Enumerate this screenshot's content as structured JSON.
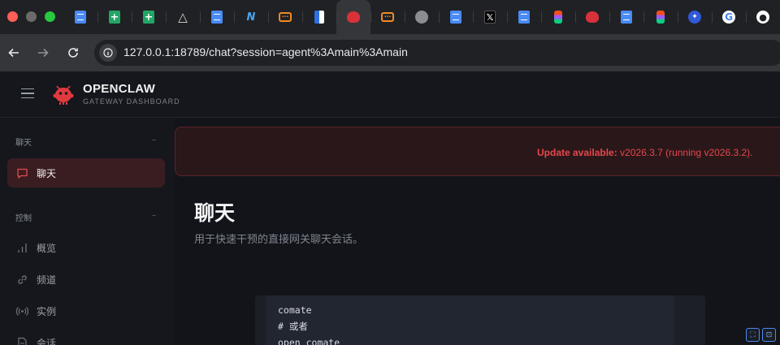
{
  "browser": {
    "tabs": [
      {
        "icon": "google-docs-icon",
        "active": false
      },
      {
        "icon": "google-sheets-icon",
        "active": false
      },
      {
        "icon": "google-sheets-icon",
        "active": false
      },
      {
        "icon": "google-drive-icon",
        "active": false
      },
      {
        "icon": "google-docs-icon",
        "active": false
      },
      {
        "icon": "m-logo-icon",
        "active": false
      },
      {
        "icon": "orange-bracket-icon",
        "active": false
      },
      {
        "icon": "split-doc-icon",
        "active": false
      },
      {
        "icon": "red-robot-icon",
        "active": true
      },
      {
        "icon": "orange-bracket-icon",
        "active": false
      },
      {
        "icon": "globe-icon",
        "active": false
      },
      {
        "icon": "google-docs-icon",
        "active": false
      },
      {
        "icon": "x-logo-icon",
        "active": false
      },
      {
        "icon": "google-docs-icon",
        "active": false
      },
      {
        "icon": "figma-icon",
        "active": false
      },
      {
        "icon": "red-robot-icon",
        "active": false
      },
      {
        "icon": "google-docs-icon",
        "active": false
      },
      {
        "icon": "figma-icon",
        "active": false
      },
      {
        "icon": "baidu-icon",
        "active": false
      },
      {
        "icon": "google-icon",
        "active": false
      },
      {
        "icon": "github-icon",
        "active": false
      }
    ],
    "x_glyph": "𝕏",
    "m_glyph": "N",
    "google_glyph": "G",
    "url": "127.0.0.1:18789/chat?session=agent%3Amain%3Amain"
  },
  "header": {
    "brand": "OPENCLAW",
    "subtitle": "GATEWAY DASHBOARD"
  },
  "sidebar": {
    "groups": [
      {
        "title": "聊天",
        "collapse_glyph": "–"
      },
      {
        "title": "控制",
        "collapse_glyph": "–"
      }
    ],
    "items": [
      {
        "label": "聊天",
        "icon": "chat-bubble-icon",
        "active": true
      },
      {
        "label": "概览",
        "icon": "bar-chart-icon",
        "active": false
      },
      {
        "label": "频道",
        "icon": "link-icon",
        "active": false
      },
      {
        "label": "实例",
        "icon": "broadcast-icon",
        "active": false
      },
      {
        "label": "会话",
        "icon": "document-icon",
        "active": false
      }
    ]
  },
  "banner": {
    "prefix": "Update available: ",
    "version_info": "v2026.3.7 (running v2026.3.2)."
  },
  "main": {
    "title": "聊天",
    "subtitle": "用于快速干预的直接网关聊天会话。",
    "code_lines": [
      "comate",
      "# 或者",
      "open comate"
    ]
  },
  "colors": {
    "accent": "#e5484d",
    "active_nav_bg": "#3a1d21",
    "background": "#12141a"
  }
}
